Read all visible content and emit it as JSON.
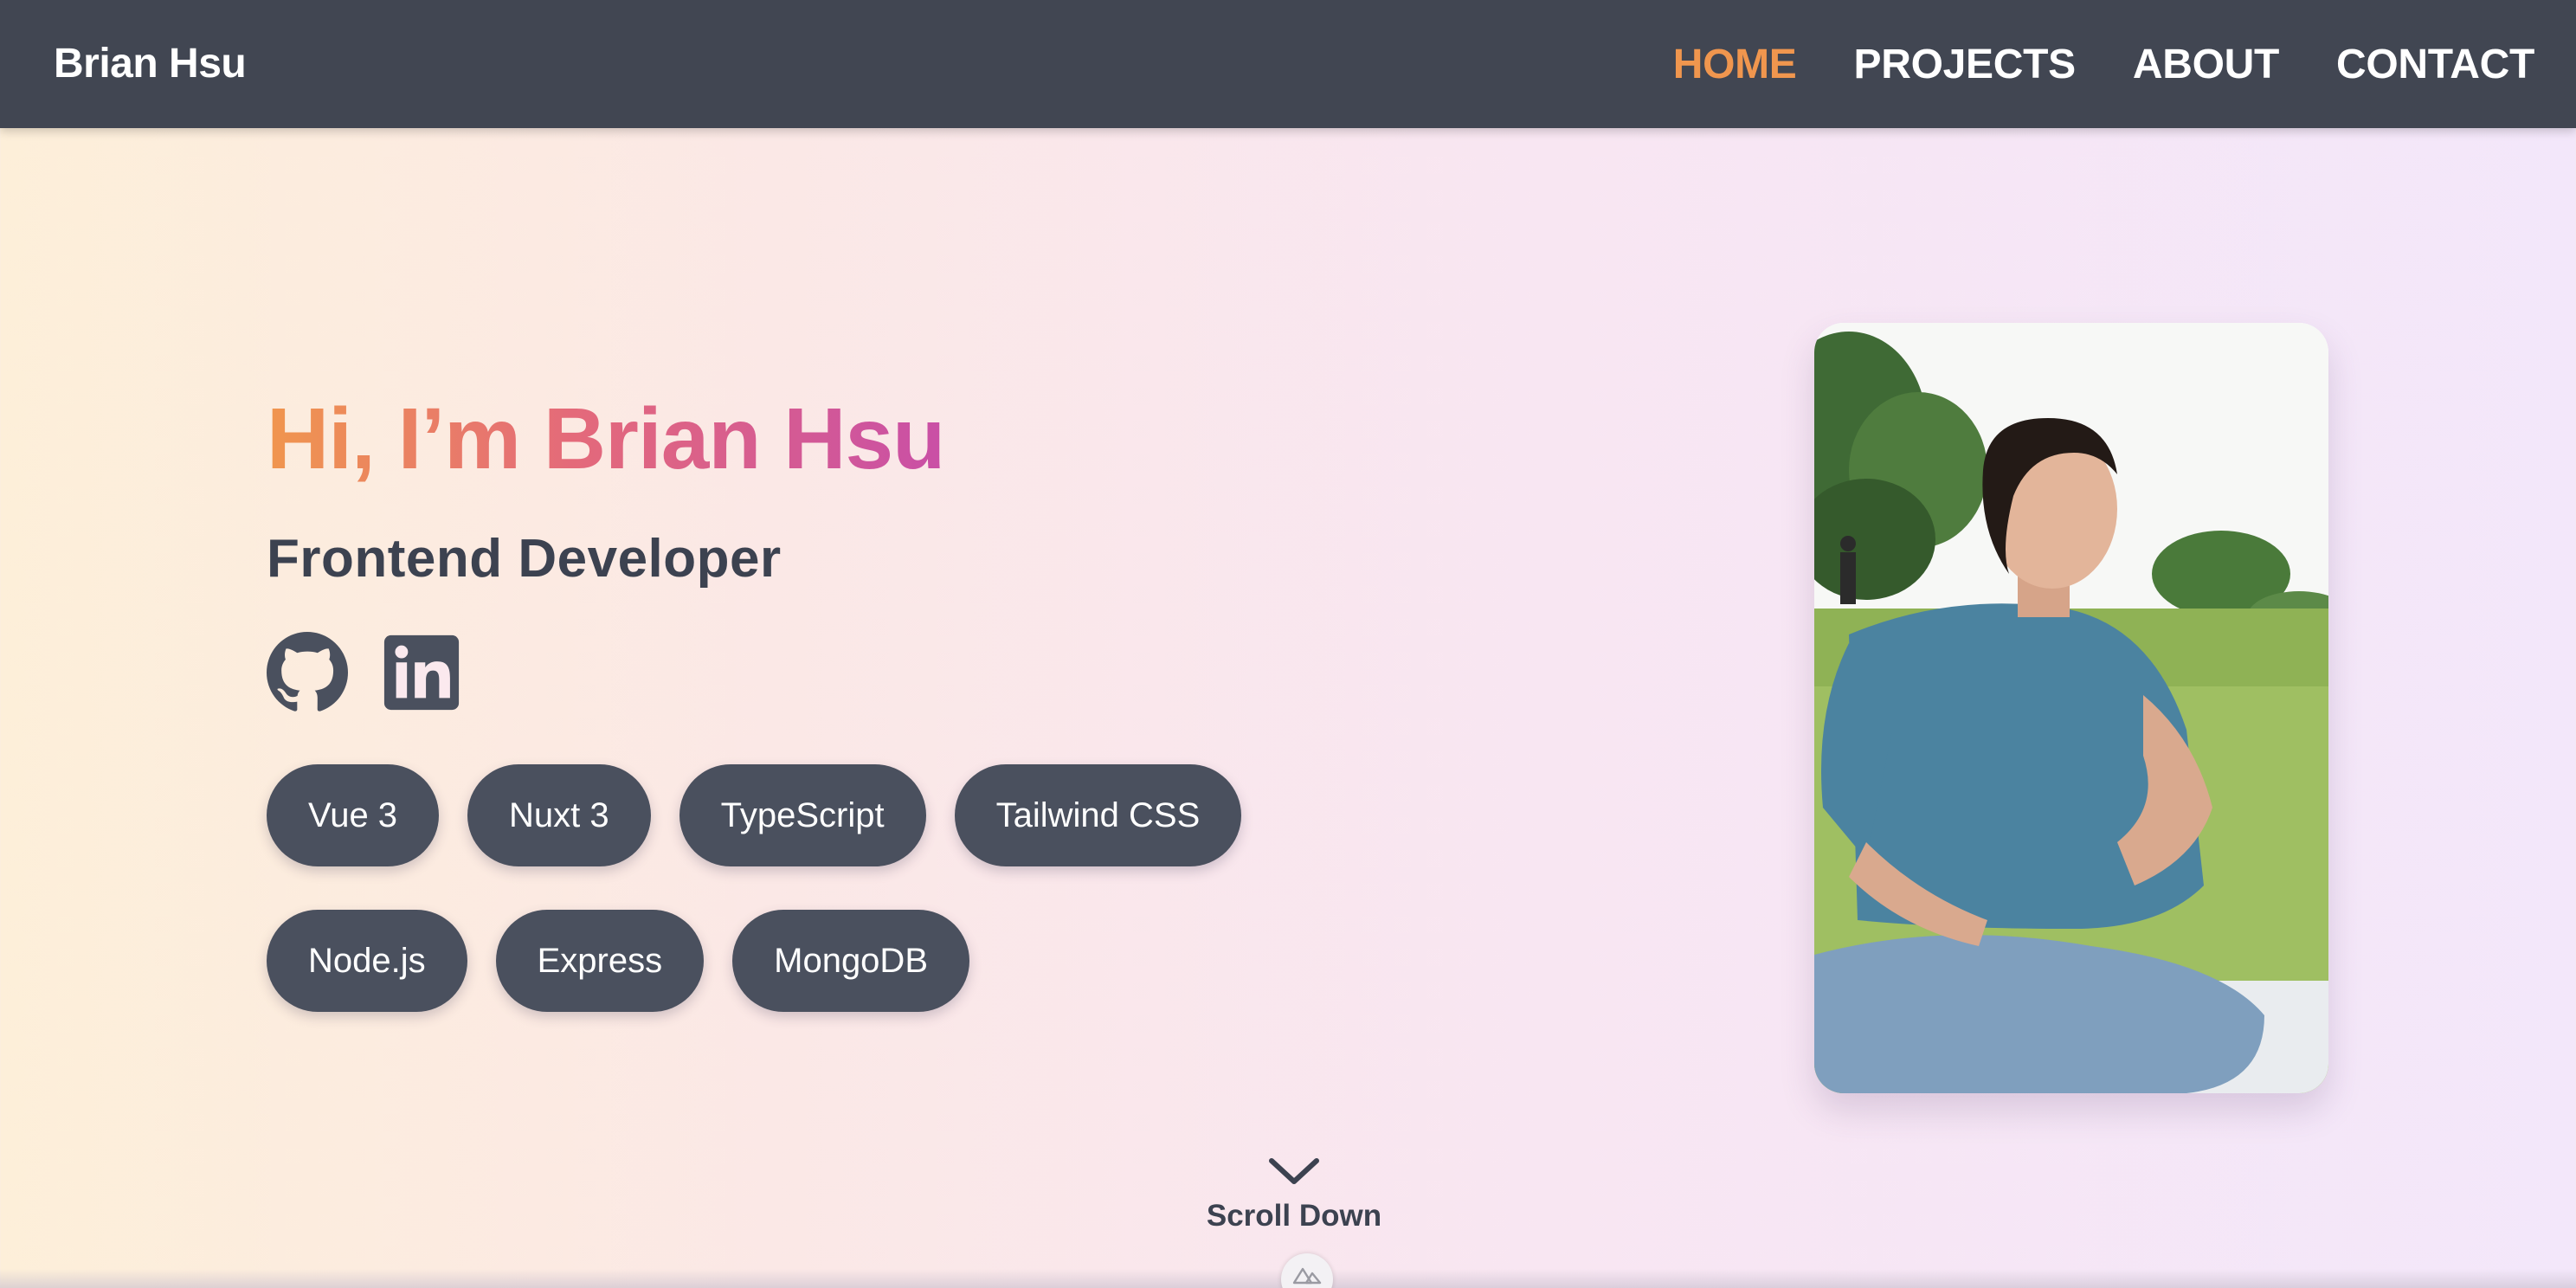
{
  "nav": {
    "brand": "Brian Hsu",
    "links": [
      {
        "label": "HOME",
        "active": true
      },
      {
        "label": "PROJECTS",
        "active": false
      },
      {
        "label": "ABOUT",
        "active": false
      },
      {
        "label": "CONTACT",
        "active": false
      }
    ],
    "active_color": "#f0964e",
    "background": "#414652"
  },
  "hero": {
    "greeting": "Hi, I’m Brian Hsu",
    "role": "Frontend Developer",
    "socials": [
      {
        "icon": "github-icon"
      },
      {
        "icon": "linkedin-icon"
      }
    ],
    "tags_row1": [
      "Vue 3",
      "Nuxt 3",
      "TypeScript",
      "Tailwind CSS"
    ],
    "tags_row2": [
      "Node.js",
      "Express",
      "MongoDB"
    ],
    "gradient_colors": [
      "#f0964e",
      "#e46a7a",
      "#c94fa6"
    ]
  },
  "photo": {
    "subject": "profile-photo"
  },
  "scroll": {
    "label": "Scroll Down",
    "icon": "chevron-down-icon"
  },
  "devtools": {
    "icon": "nuxt-icon"
  }
}
